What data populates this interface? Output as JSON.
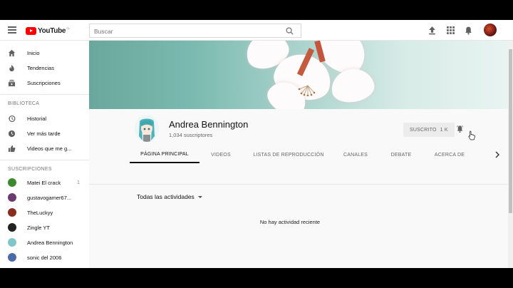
{
  "header": {
    "logo_text": "YouTube",
    "logo_region": "CL",
    "search": {
      "placeholder": "Buscar",
      "value": ""
    }
  },
  "sidebar": {
    "main_items": [
      {
        "label": "Inicio",
        "icon": "home-icon"
      },
      {
        "label": "Tendencias",
        "icon": "flame-icon"
      },
      {
        "label": "Suscripciones",
        "icon": "subscriptions-icon"
      }
    ],
    "library_heading": "BIBLIOTECA",
    "library_items": [
      {
        "label": "Historial",
        "icon": "history-icon"
      },
      {
        "label": "Ver más tarde",
        "icon": "clock-icon"
      },
      {
        "label": "Videos que me g...",
        "icon": "thumbs-up-icon"
      }
    ],
    "subs_heading": "SUSCRIPCIONES",
    "subscriptions": [
      {
        "label": "Matei El crack",
        "count": "1",
        "color": "#3c8a2e"
      },
      {
        "label": "gustavogamer67...",
        "count": "",
        "color": "#6b3a6e"
      },
      {
        "label": "TheLuckyy",
        "count": "",
        "color": "#8a2d1e"
      },
      {
        "label": "Zingle YT",
        "count": "",
        "color": "#222222"
      },
      {
        "label": "Andrea Bennington",
        "count": "",
        "color": "#7fc6c9"
      },
      {
        "label": "sonic del 2006",
        "count": "",
        "color": "#4a6aa8"
      }
    ]
  },
  "channel": {
    "name": "Andrea Bennington",
    "subscribers": "1,034 suscriptores",
    "subscribe_label": "SUSCRITO",
    "subscribe_count": "1 K",
    "tabs": [
      "PÁGINA PRINCIPAL",
      "VIDEOS",
      "LISTAS DE REPRODUCCIÓN",
      "CANALES",
      "DEBATE",
      "ACERCA DE"
    ],
    "active_tab": "PÁGINA PRINCIPAL",
    "filter_label": "Todas las actividades",
    "empty_message": "No hay actividad reciente"
  },
  "colors": {
    "brand_red": "#ff0000",
    "accent_text": "#111111",
    "muted_text": "#666666"
  }
}
